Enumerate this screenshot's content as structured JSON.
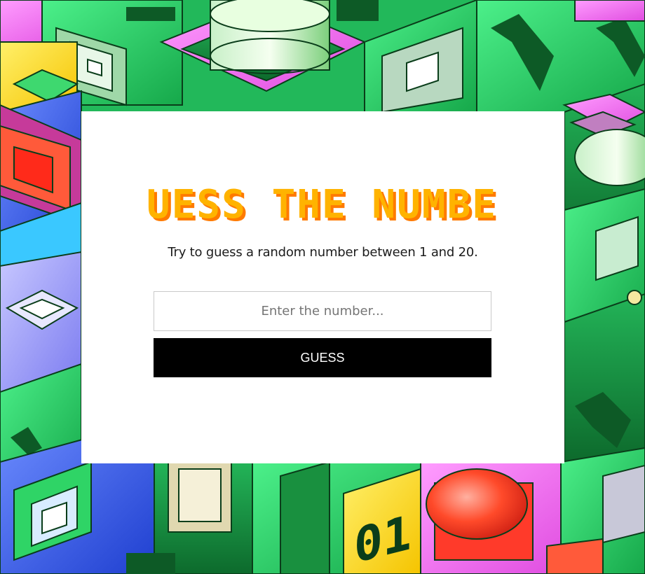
{
  "game": {
    "title": "GUESS THE NUMBER",
    "instructions": "Try to guess a random number between 1 and 20.",
    "input_placeholder": "Enter the number...",
    "input_value": "",
    "guess_button_label": "GUESS",
    "title_color": "#ffb300",
    "title_shadow_color": "#ff7a00"
  },
  "background": {
    "decoration_text": "01",
    "palette": [
      "#2fd466",
      "#1a8c3c",
      "#ff70ff",
      "#ffd400",
      "#3b6bff",
      "#ff3a2a",
      "#9fa0ff"
    ]
  }
}
